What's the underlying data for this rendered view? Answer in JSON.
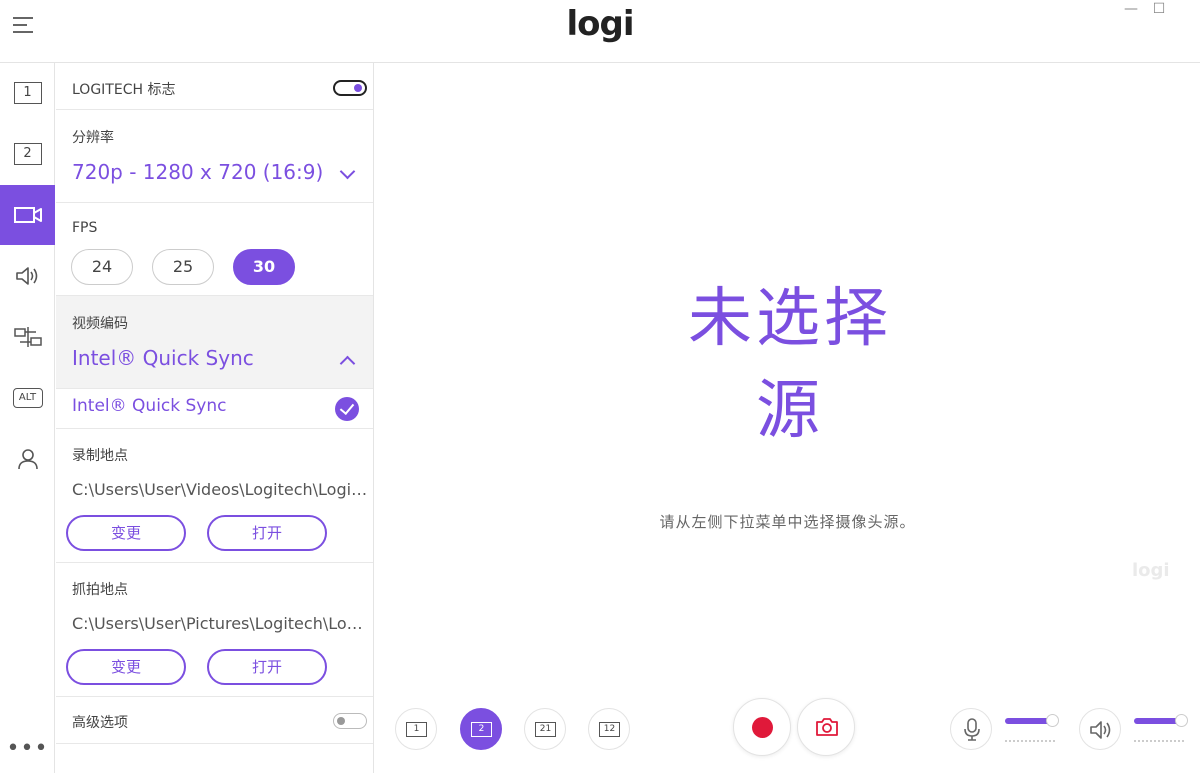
{
  "app": {
    "logo_text": "logi",
    "window_controls": {
      "minimize": "—",
      "maximize": "☐"
    }
  },
  "sidebar": {
    "items": [
      {
        "label": "1",
        "name": "layout-1"
      },
      {
        "label": "2",
        "name": "layout-2"
      },
      {
        "label": "",
        "name": "camera"
      },
      {
        "label": "",
        "name": "audio"
      },
      {
        "label": "",
        "name": "transitions"
      },
      {
        "label": "ALT",
        "name": "alt"
      },
      {
        "label": "",
        "name": "account"
      }
    ],
    "more_label": "•••"
  },
  "panel": {
    "logo_toggle": {
      "label": "LOGITECH 标志",
      "on": true
    },
    "resolution": {
      "label": "分辨率",
      "value": "720p - 1280 x 720 (16:9)"
    },
    "fps": {
      "label": "FPS",
      "options": [
        "24",
        "25",
        "30"
      ],
      "selected": "30"
    },
    "encoder": {
      "label": "视频编码",
      "value": "Intel® Quick Sync",
      "options": [
        "Intel® Quick Sync"
      ]
    },
    "record_location": {
      "label": "录制地点",
      "path": "C:\\Users\\User\\Videos\\Logitech\\LogiCapture",
      "change_label": "变更",
      "open_label": "打开"
    },
    "capture_location": {
      "label": "抓拍地点",
      "path": "C:\\Users\\User\\Pictures\\Logitech\\LogiCapture",
      "change_label": "变更",
      "open_label": "打开"
    },
    "advanced": {
      "label": "高级选项",
      "on": false
    }
  },
  "preview": {
    "no_source_title": "未选择源",
    "hint": "请从左侧下拉菜单中选择摄像头源。",
    "watermark": "logi"
  },
  "controls": {
    "layouts": [
      {
        "label": "1",
        "name": "layout-single-button"
      },
      {
        "label": "2",
        "name": "layout-dual-button"
      },
      {
        "label": "21",
        "name": "layout-pip-left-button"
      },
      {
        "label": "12",
        "name": "layout-pip-right-button"
      }
    ],
    "selected_layout": "2",
    "mic_level": 0.9,
    "speaker_level": 0.9
  },
  "colors": {
    "accent": "#7b4fe0",
    "record": "#e0193a"
  }
}
